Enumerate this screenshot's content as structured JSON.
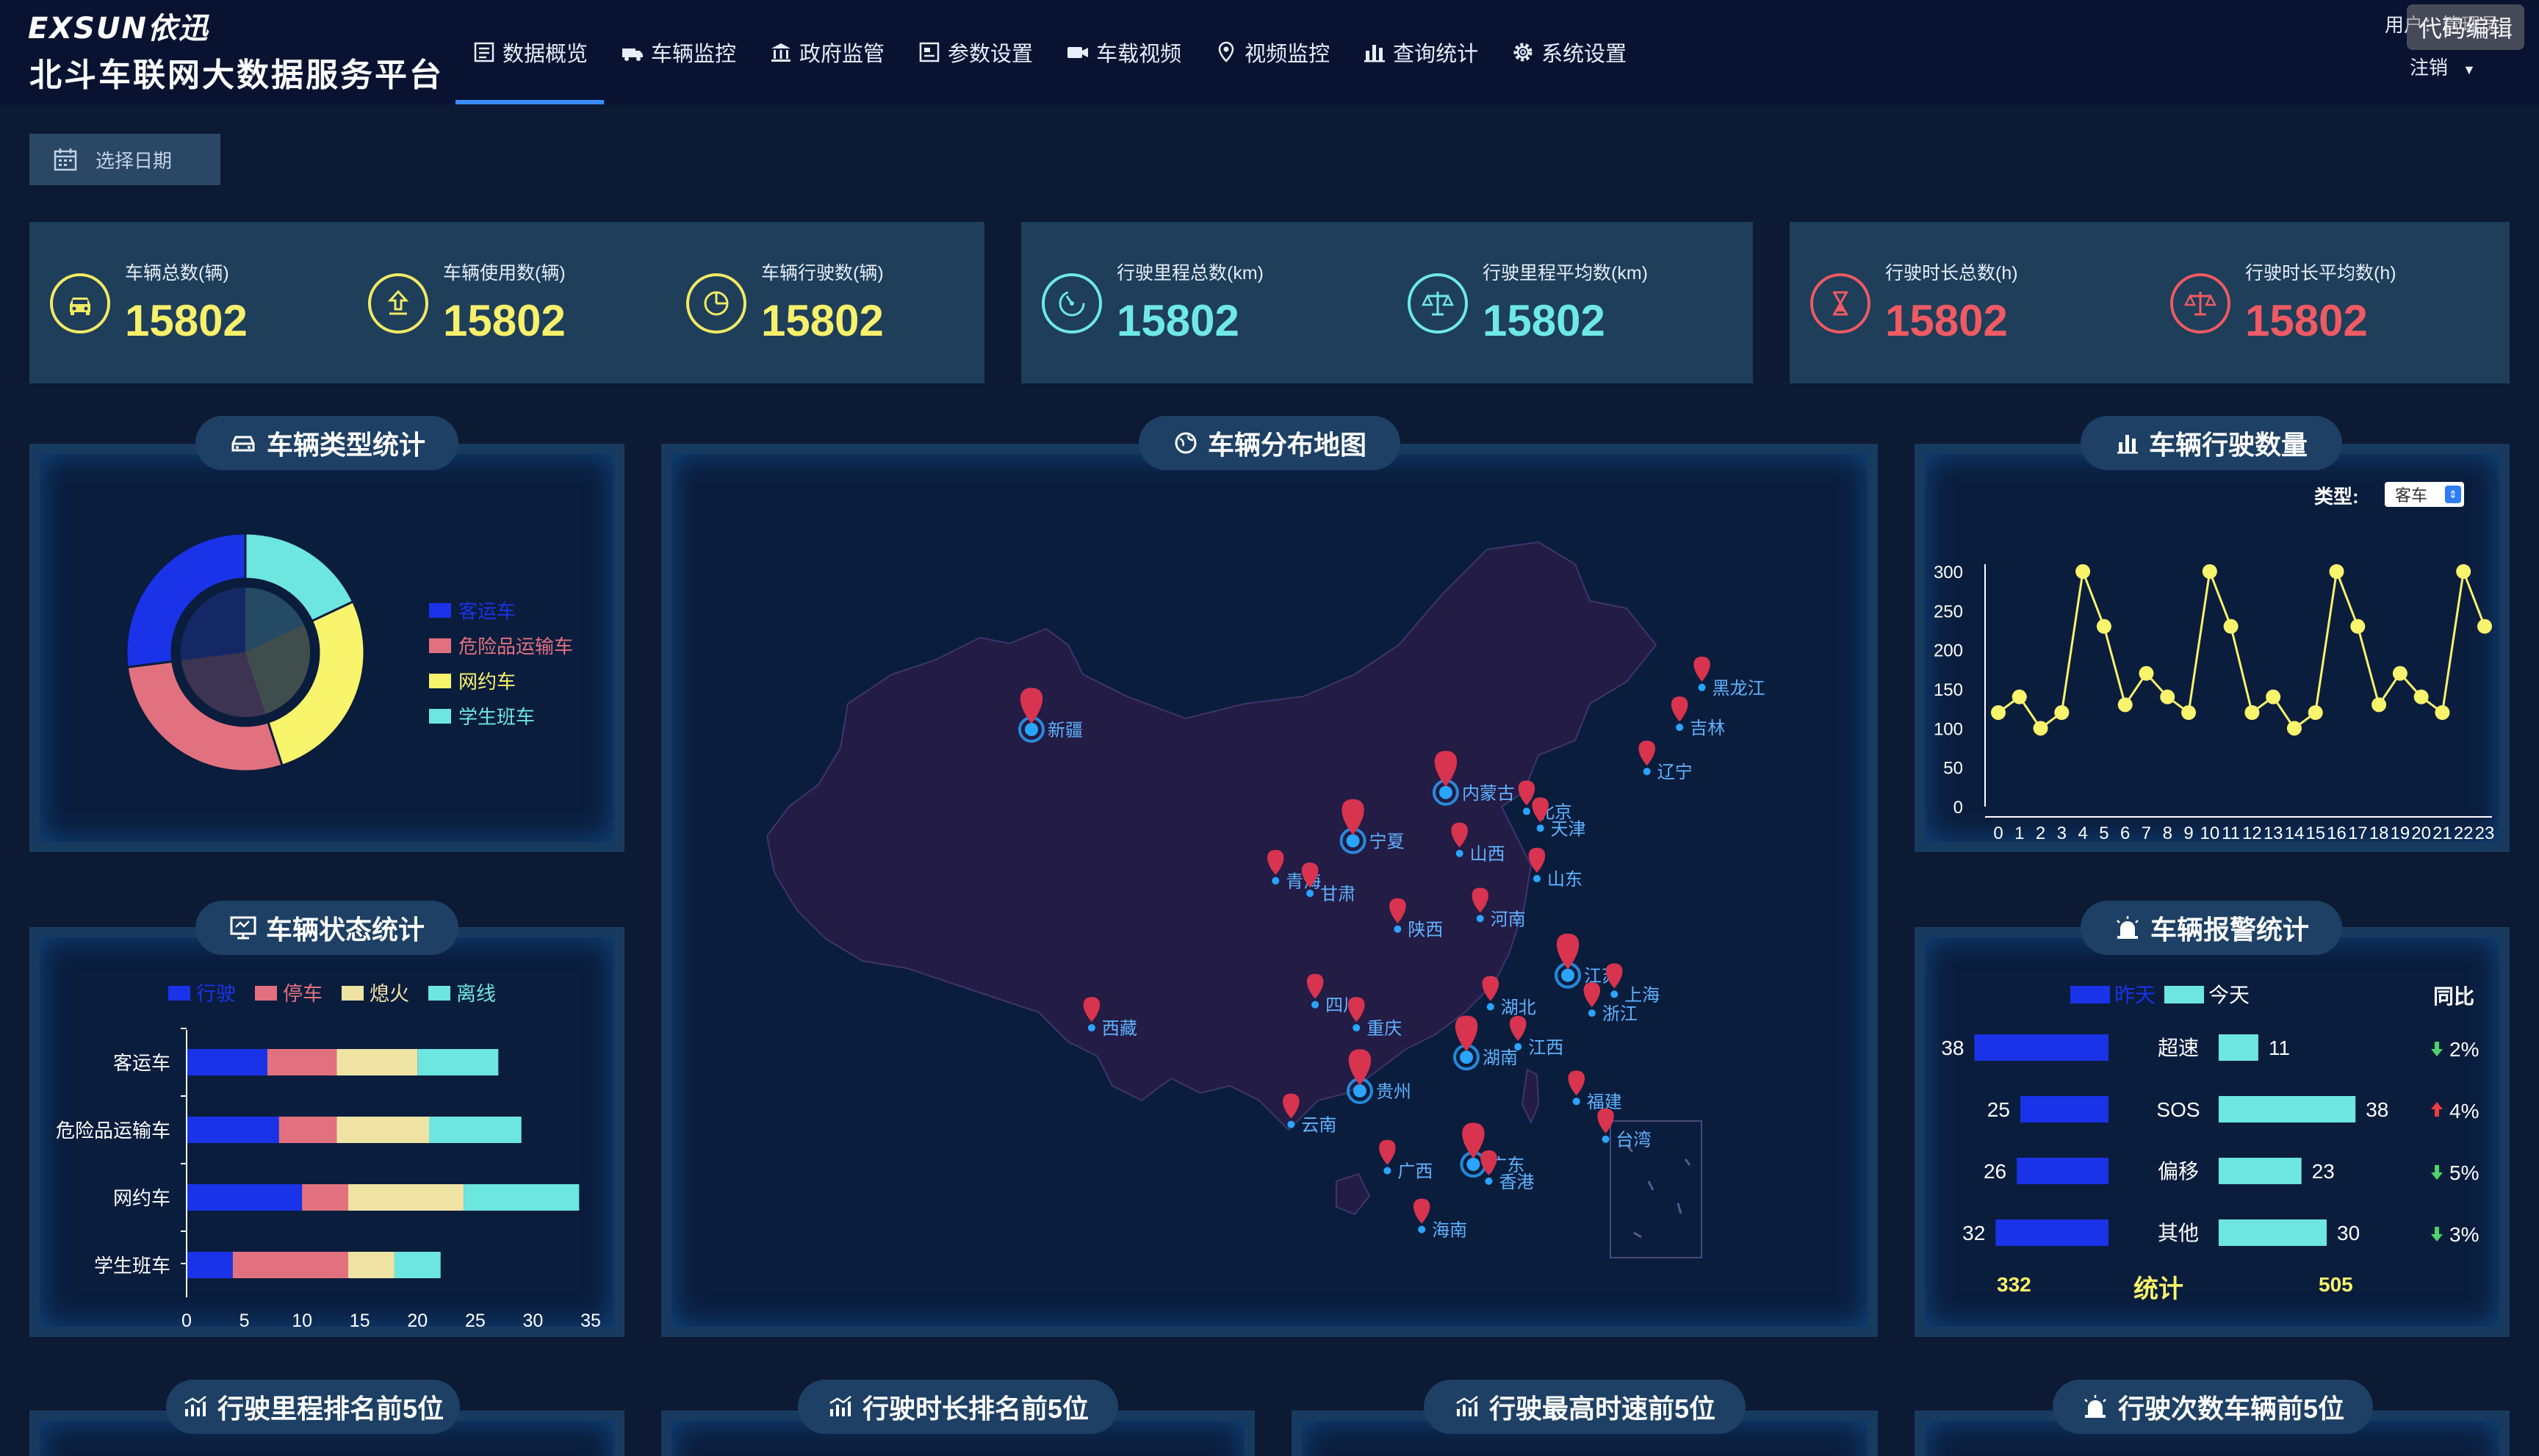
{
  "header": {
    "logo_text": "EXSUN依迅",
    "title": "北斗车联网大数据服务平台",
    "nav": [
      {
        "label": "数据概览",
        "icon": "dashboard-icon",
        "active": true
      },
      {
        "label": "车辆监控",
        "icon": "truck-icon"
      },
      {
        "label": "政府监管",
        "icon": "government-icon"
      },
      {
        "label": "参数设置",
        "icon": "settings-panel-icon"
      },
      {
        "label": "车载视频",
        "icon": "video-camera-icon"
      },
      {
        "label": "视频监控",
        "icon": "location-pin-icon"
      },
      {
        "label": "查询统计",
        "icon": "bar-chart-icon"
      },
      {
        "label": "系统设置",
        "icon": "gear-icon"
      }
    ],
    "user_label": "用户：管理员",
    "logout_label": "注销",
    "watermark": "代码编辑"
  },
  "date_picker": {
    "placeholder": "选择日期"
  },
  "stats": [
    {
      "label": "车辆总数(辆)",
      "value": "15802",
      "icon": "car-icon",
      "color": "#f7f06a"
    },
    {
      "label": "车辆使用数(辆)",
      "value": "15802",
      "icon": "upload-arrow-icon",
      "color": "#f7f06a"
    },
    {
      "label": "车辆行驶数(辆)",
      "value": "15802",
      "icon": "pie-clock-icon",
      "color": "#f7f06a"
    },
    {
      "label": "行驶里程总数(km)",
      "value": "15802",
      "icon": "speedometer-icon",
      "color": "#6ee8e6"
    },
    {
      "label": "行驶里程平均数(km)",
      "value": "15802",
      "icon": "scale-icon",
      "color": "#6ee8e6"
    },
    {
      "label": "行驶时长总数(h)",
      "value": "15802",
      "icon": "hourglass-icon",
      "color": "#ef5a63"
    },
    {
      "label": "行驶时长平均数(h)",
      "value": "15802",
      "icon": "scale-icon",
      "color": "#ef5a63"
    }
  ],
  "panels": {
    "vehicle_type": "车辆类型统计",
    "map": "车辆分布地图",
    "driving_count": "车辆行驶数量",
    "vehicle_status": "车辆状态统计",
    "alarm": "车辆报警统计",
    "mileage_rank": "行驶里程排名前5位",
    "duration_rank": "行驶时长排名前5位",
    "speed_rank": "行驶最高时速前5位",
    "trips_rank": "行驶次数车辆前5位"
  },
  "driving_count_filter": {
    "label": "类型:",
    "selected": "客车"
  },
  "chart_data": [
    {
      "id": "vehicle_type",
      "type": "pie",
      "labels": [
        "客运车",
        "危险品运输车",
        "网约车",
        "学生班车"
      ],
      "values": [
        27,
        28,
        27,
        18
      ],
      "colors": [
        "#1a33e8",
        "#e2717f",
        "#f8f46b",
        "#6de6e0"
      ]
    },
    {
      "id": "driving_count",
      "type": "line",
      "x": [
        0,
        1,
        2,
        3,
        4,
        5,
        6,
        7,
        8,
        9,
        10,
        11,
        12,
        13,
        14,
        15,
        16,
        17,
        18,
        19,
        20,
        21,
        22,
        23
      ],
      "values": [
        120,
        140,
        100,
        120,
        300,
        230,
        130,
        170,
        140,
        120,
        300,
        230,
        120,
        140,
        100,
        120,
        300,
        230,
        130,
        170,
        140,
        120,
        300,
        230
      ],
      "ylim": [
        0,
        300
      ],
      "yticks": [
        0,
        50,
        100,
        150,
        200,
        250,
        300
      ],
      "color": "#f8f46b"
    },
    {
      "id": "vehicle_status",
      "type": "bar",
      "orientation": "horizontal",
      "stacked": true,
      "categories": [
        "客运车",
        "危险品运输车",
        "网约车",
        "学生班车"
      ],
      "series": [
        {
          "name": "行驶",
          "values": [
            7,
            8,
            10,
            4
          ],
          "color": "#1a33e8"
        },
        {
          "name": "停车",
          "values": [
            6,
            5,
            4,
            10
          ],
          "color": "#e2717f"
        },
        {
          "name": "熄火",
          "values": [
            7,
            8,
            10,
            4
          ],
          "color": "#efe3a4"
        },
        {
          "name": "离线",
          "values": [
            7,
            8,
            10,
            4
          ],
          "color": "#6de6e0"
        }
      ],
      "xlim": [
        0,
        35
      ],
      "xticks": [
        0,
        5,
        10,
        15,
        20,
        25,
        30,
        35
      ]
    },
    {
      "id": "alarm",
      "type": "bar",
      "categories": [
        "超速",
        "SOS",
        "偏移",
        "其他"
      ],
      "series": [
        {
          "name": "昨天",
          "values": [
            38,
            25,
            26,
            32
          ],
          "color": "#1a33e8"
        },
        {
          "name": "今天",
          "values": [
            11,
            38,
            23,
            30
          ],
          "color": "#6de6e0"
        }
      ],
      "yoy_header": "同比",
      "yoy": [
        {
          "dir": "down",
          "text": "2%"
        },
        {
          "dir": "up",
          "text": "4%"
        },
        {
          "dir": "down",
          "text": "5%"
        },
        {
          "dir": "down",
          "text": "3%"
        }
      ],
      "totals": {
        "label": "统计",
        "yesterday": "332",
        "today": "505"
      }
    }
  ],
  "map": {
    "markers": [
      {
        "name": "新疆",
        "lon": 87.6,
        "lat": 43.8,
        "big": true
      },
      {
        "name": "西藏",
        "lon": 91.1,
        "lat": 29.6
      },
      {
        "name": "青海",
        "lon": 101.8,
        "lat": 36.6
      },
      {
        "name": "甘肃",
        "lon": 103.8,
        "lat": 36.0
      },
      {
        "name": "宁夏",
        "lon": 106.3,
        "lat": 38.5,
        "big": true
      },
      {
        "name": "内蒙古",
        "lon": 111.7,
        "lat": 40.8,
        "big": true
      },
      {
        "name": "黑龙江",
        "lon": 126.6,
        "lat": 45.8
      },
      {
        "name": "吉林",
        "lon": 125.3,
        "lat": 43.9
      },
      {
        "name": "辽宁",
        "lon": 123.4,
        "lat": 41.8
      },
      {
        "name": "北京",
        "lon": 116.4,
        "lat": 39.9
      },
      {
        "name": "天津",
        "lon": 117.2,
        "lat": 39.1
      },
      {
        "name": "山西",
        "lon": 112.5,
        "lat": 37.9
      },
      {
        "name": "山东",
        "lon": 117.0,
        "lat": 36.7
      },
      {
        "name": "陕西",
        "lon": 108.9,
        "lat": 34.3
      },
      {
        "name": "河南",
        "lon": 113.7,
        "lat": 34.8
      },
      {
        "name": "四川",
        "lon": 104.1,
        "lat": 30.7
      },
      {
        "name": "重庆",
        "lon": 106.5,
        "lat": 29.6
      },
      {
        "name": "湖北",
        "lon": 114.3,
        "lat": 30.6
      },
      {
        "name": "江苏",
        "lon": 118.8,
        "lat": 32.1,
        "big": true
      },
      {
        "name": "上海",
        "lon": 121.5,
        "lat": 31.2
      },
      {
        "name": "浙江",
        "lon": 120.2,
        "lat": 30.3
      },
      {
        "name": "湖南",
        "lon": 112.9,
        "lat": 28.2,
        "big": true
      },
      {
        "name": "江西",
        "lon": 115.9,
        "lat": 28.7
      },
      {
        "name": "贵州",
        "lon": 106.7,
        "lat": 26.6,
        "big": true
      },
      {
        "name": "云南",
        "lon": 102.7,
        "lat": 25.0
      },
      {
        "name": "福建",
        "lon": 119.3,
        "lat": 26.1
      },
      {
        "name": "台湾",
        "lon": 121.0,
        "lat": 24.3
      },
      {
        "name": "广西",
        "lon": 108.3,
        "lat": 22.8
      },
      {
        "name": "广东",
        "lon": 113.3,
        "lat": 23.1,
        "big": true
      },
      {
        "name": "香港",
        "lon": 114.2,
        "lat": 22.3
      },
      {
        "name": "海南",
        "lon": 110.3,
        "lat": 20.0
      }
    ]
  }
}
